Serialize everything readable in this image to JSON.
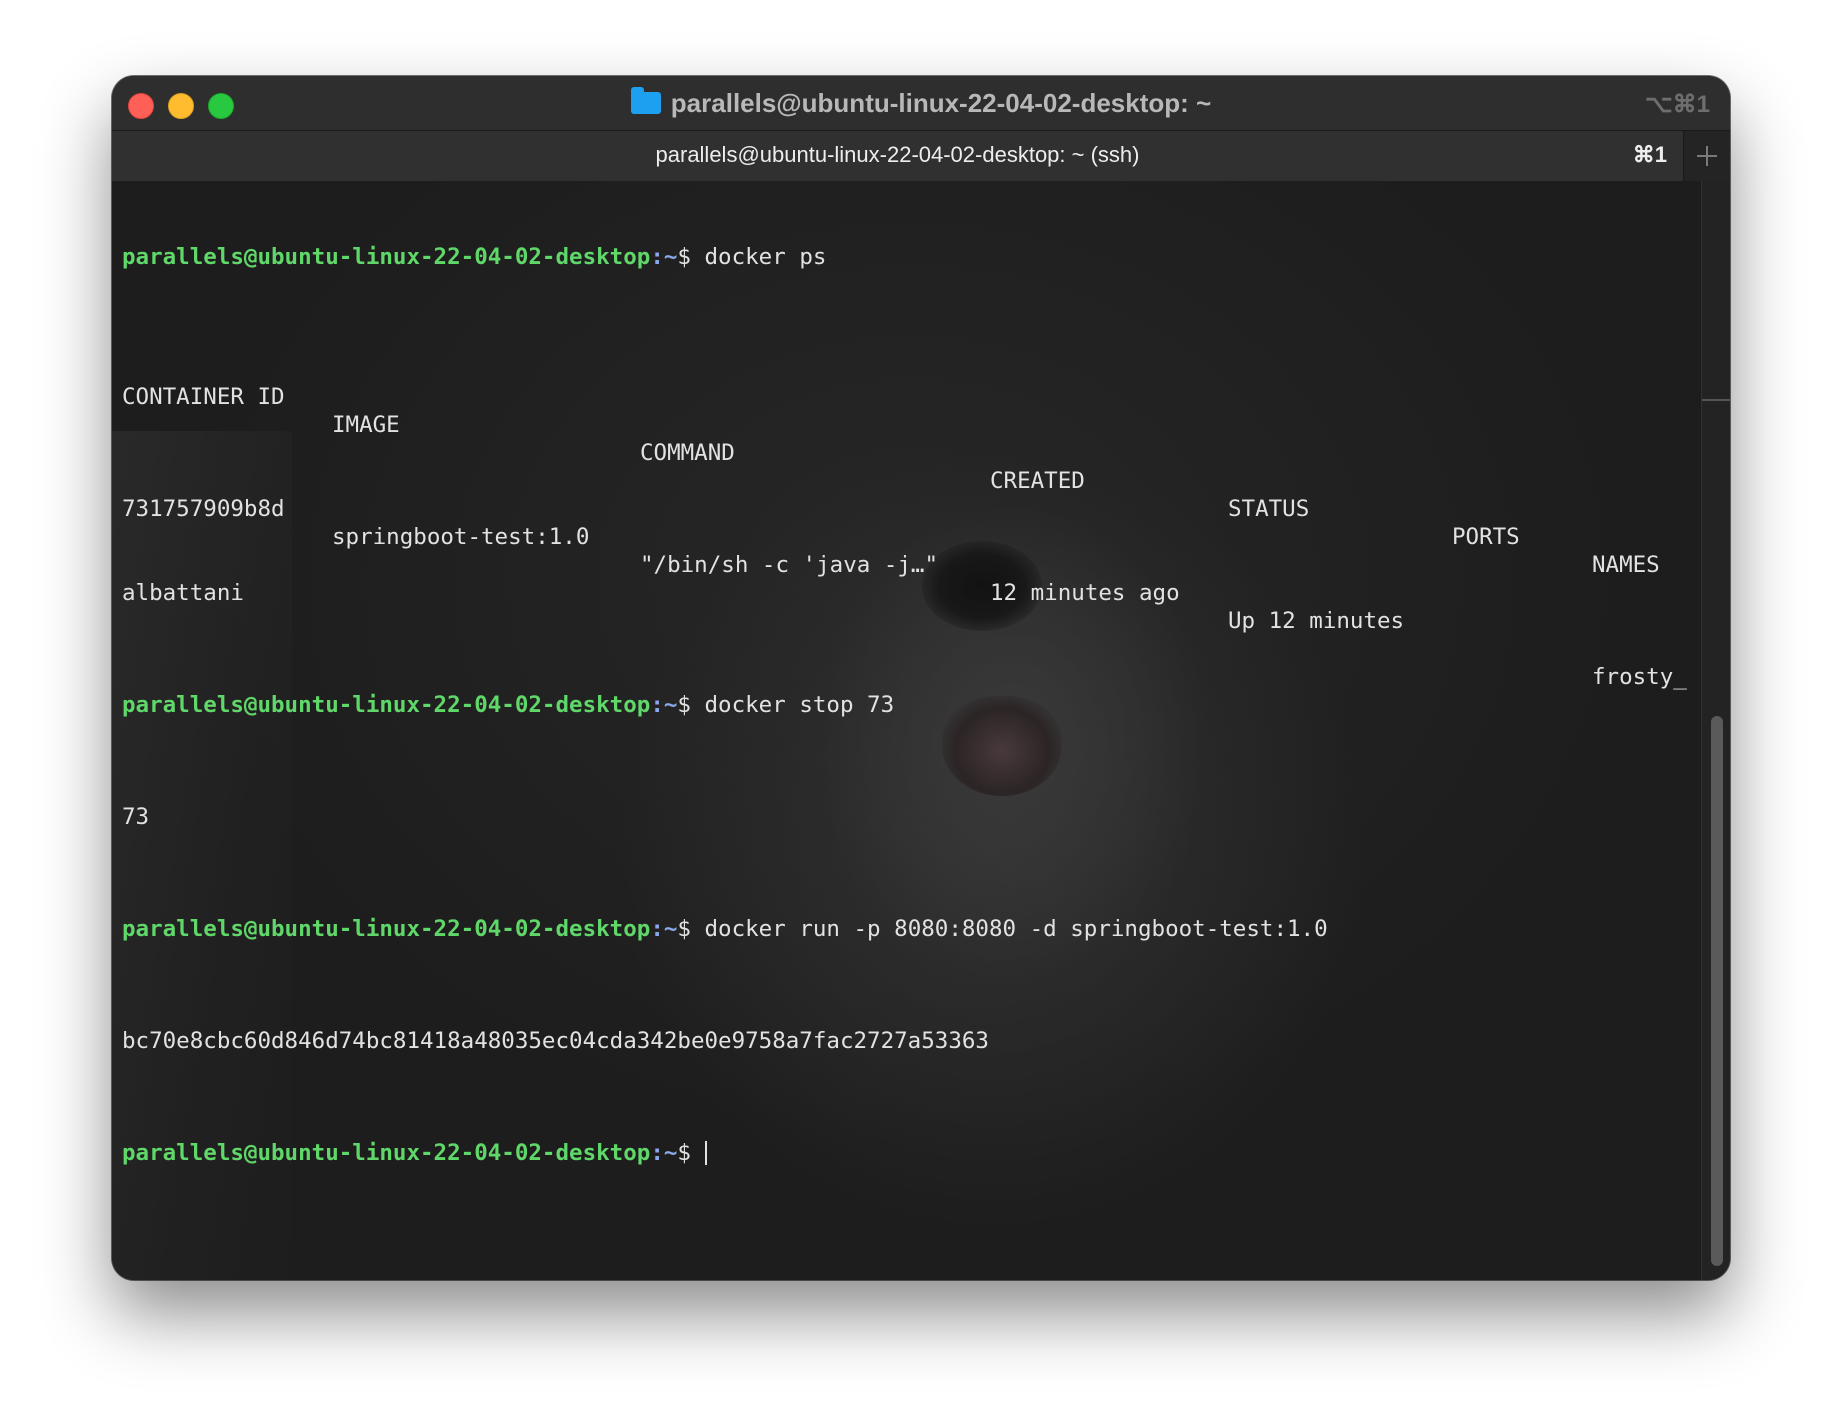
{
  "window": {
    "title": "parallels@ubuntu-linux-22-04-02-desktop: ~",
    "shortcut": "⌥⌘1"
  },
  "tab": {
    "title": "parallels@ubuntu-linux-22-04-02-desktop: ~ (ssh)",
    "shortcut": "⌘1"
  },
  "terminal": {
    "prompt_user": "parallels@ubuntu-linux-22-04-02-desktop",
    "prompt_sep": ":",
    "prompt_path": "~",
    "prompt_symbol": "$ ",
    "commands": {
      "ps": "docker ps",
      "stop": "docker stop 73",
      "run": "docker run -p 8080:8080 -d springboot-test:1.0"
    },
    "ps_table": {
      "headers": {
        "container_id": "CONTAINER ID",
        "image": "IMAGE",
        "command": "COMMAND",
        "created": "CREATED",
        "status": "STATUS",
        "ports": "PORTS",
        "names": "NAMES"
      },
      "row": {
        "container_id": "731757909b8d",
        "image": "springboot-test:1.0",
        "command": "\"/bin/sh -c 'java -j…\"",
        "created": "12 minutes ago",
        "status": "Up 12 minutes",
        "ports": "",
        "names": "frosty_",
        "names_wrap": "albattani"
      }
    },
    "stop_output": "73",
    "run_output": "bc70e8cbc60d846d74bc81418a48035ec04cda342be0e9758a7fac2727a53363"
  }
}
